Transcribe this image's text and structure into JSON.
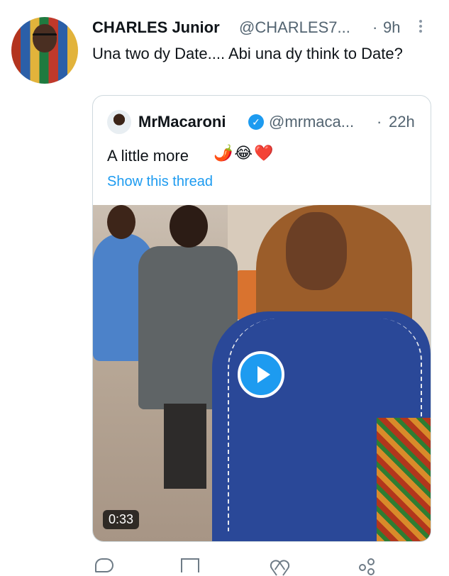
{
  "tweet": {
    "author_name": "CHARLES Junior",
    "author_handle": "@CHARLES7...",
    "separator": "·",
    "time": "9h",
    "text": "Una two dy Date.... Abi una dy think to Date?"
  },
  "quoted_tweet": {
    "author_name": "MrMacaroni",
    "author_handle": "@mrmaca...",
    "separator": "·",
    "time": "22h",
    "text": "A little more",
    "emoji": "🌶️😂❤️",
    "show_thread_label": "Show this thread",
    "video": {
      "duration": "0:33",
      "play_icon": "play-icon"
    }
  },
  "actions": {
    "icons": [
      "reply-icon",
      "retweet-icon",
      "like-icon",
      "share-icon"
    ]
  },
  "colors": {
    "accent": "#1d9bf0",
    "muted_text": "#536471",
    "border": "#cfd9de"
  }
}
